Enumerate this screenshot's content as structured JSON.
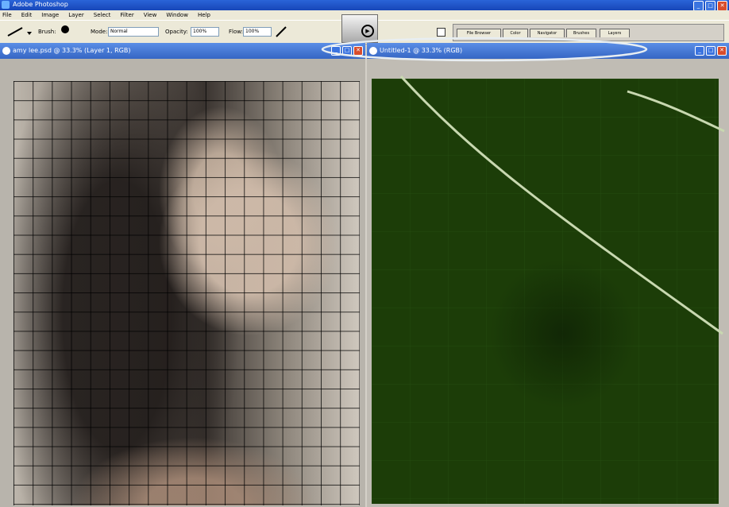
{
  "app": {
    "title": "Adobe Photoshop",
    "window_buttons": [
      "_",
      "□",
      "✕"
    ]
  },
  "menu": [
    "File",
    "Edit",
    "Image",
    "Layer",
    "Select",
    "Filter",
    "View",
    "Window",
    "Help"
  ],
  "options_bar": {
    "brush_label": "Brush:",
    "mode_label": "Mode:",
    "mode_value": "Normal",
    "opacity_label": "Opacity:",
    "opacity_value": "100%",
    "flow_label": "Flow:",
    "flow_value": "100%"
  },
  "palette_tabs": [
    "File Browser",
    "Color",
    "Navigator",
    "Brushes",
    "Layers"
  ],
  "documents": [
    {
      "title": "amy lee.psd @ 33.3% (Layer 1, RGB)"
    },
    {
      "title": "Untitled-1 @ 33.3% (RGB)"
    }
  ],
  "colors": {
    "title_bar": "#1f55c8",
    "doc_title_bar": "#4a7ed8",
    "canvas_green": "#1c3d08",
    "annotation": "#ffffff"
  },
  "icons": [
    "brush-icon",
    "brush-dot-icon",
    "airbrush-icon",
    "go-arrow-icon",
    "palette-toggle-icon"
  ]
}
